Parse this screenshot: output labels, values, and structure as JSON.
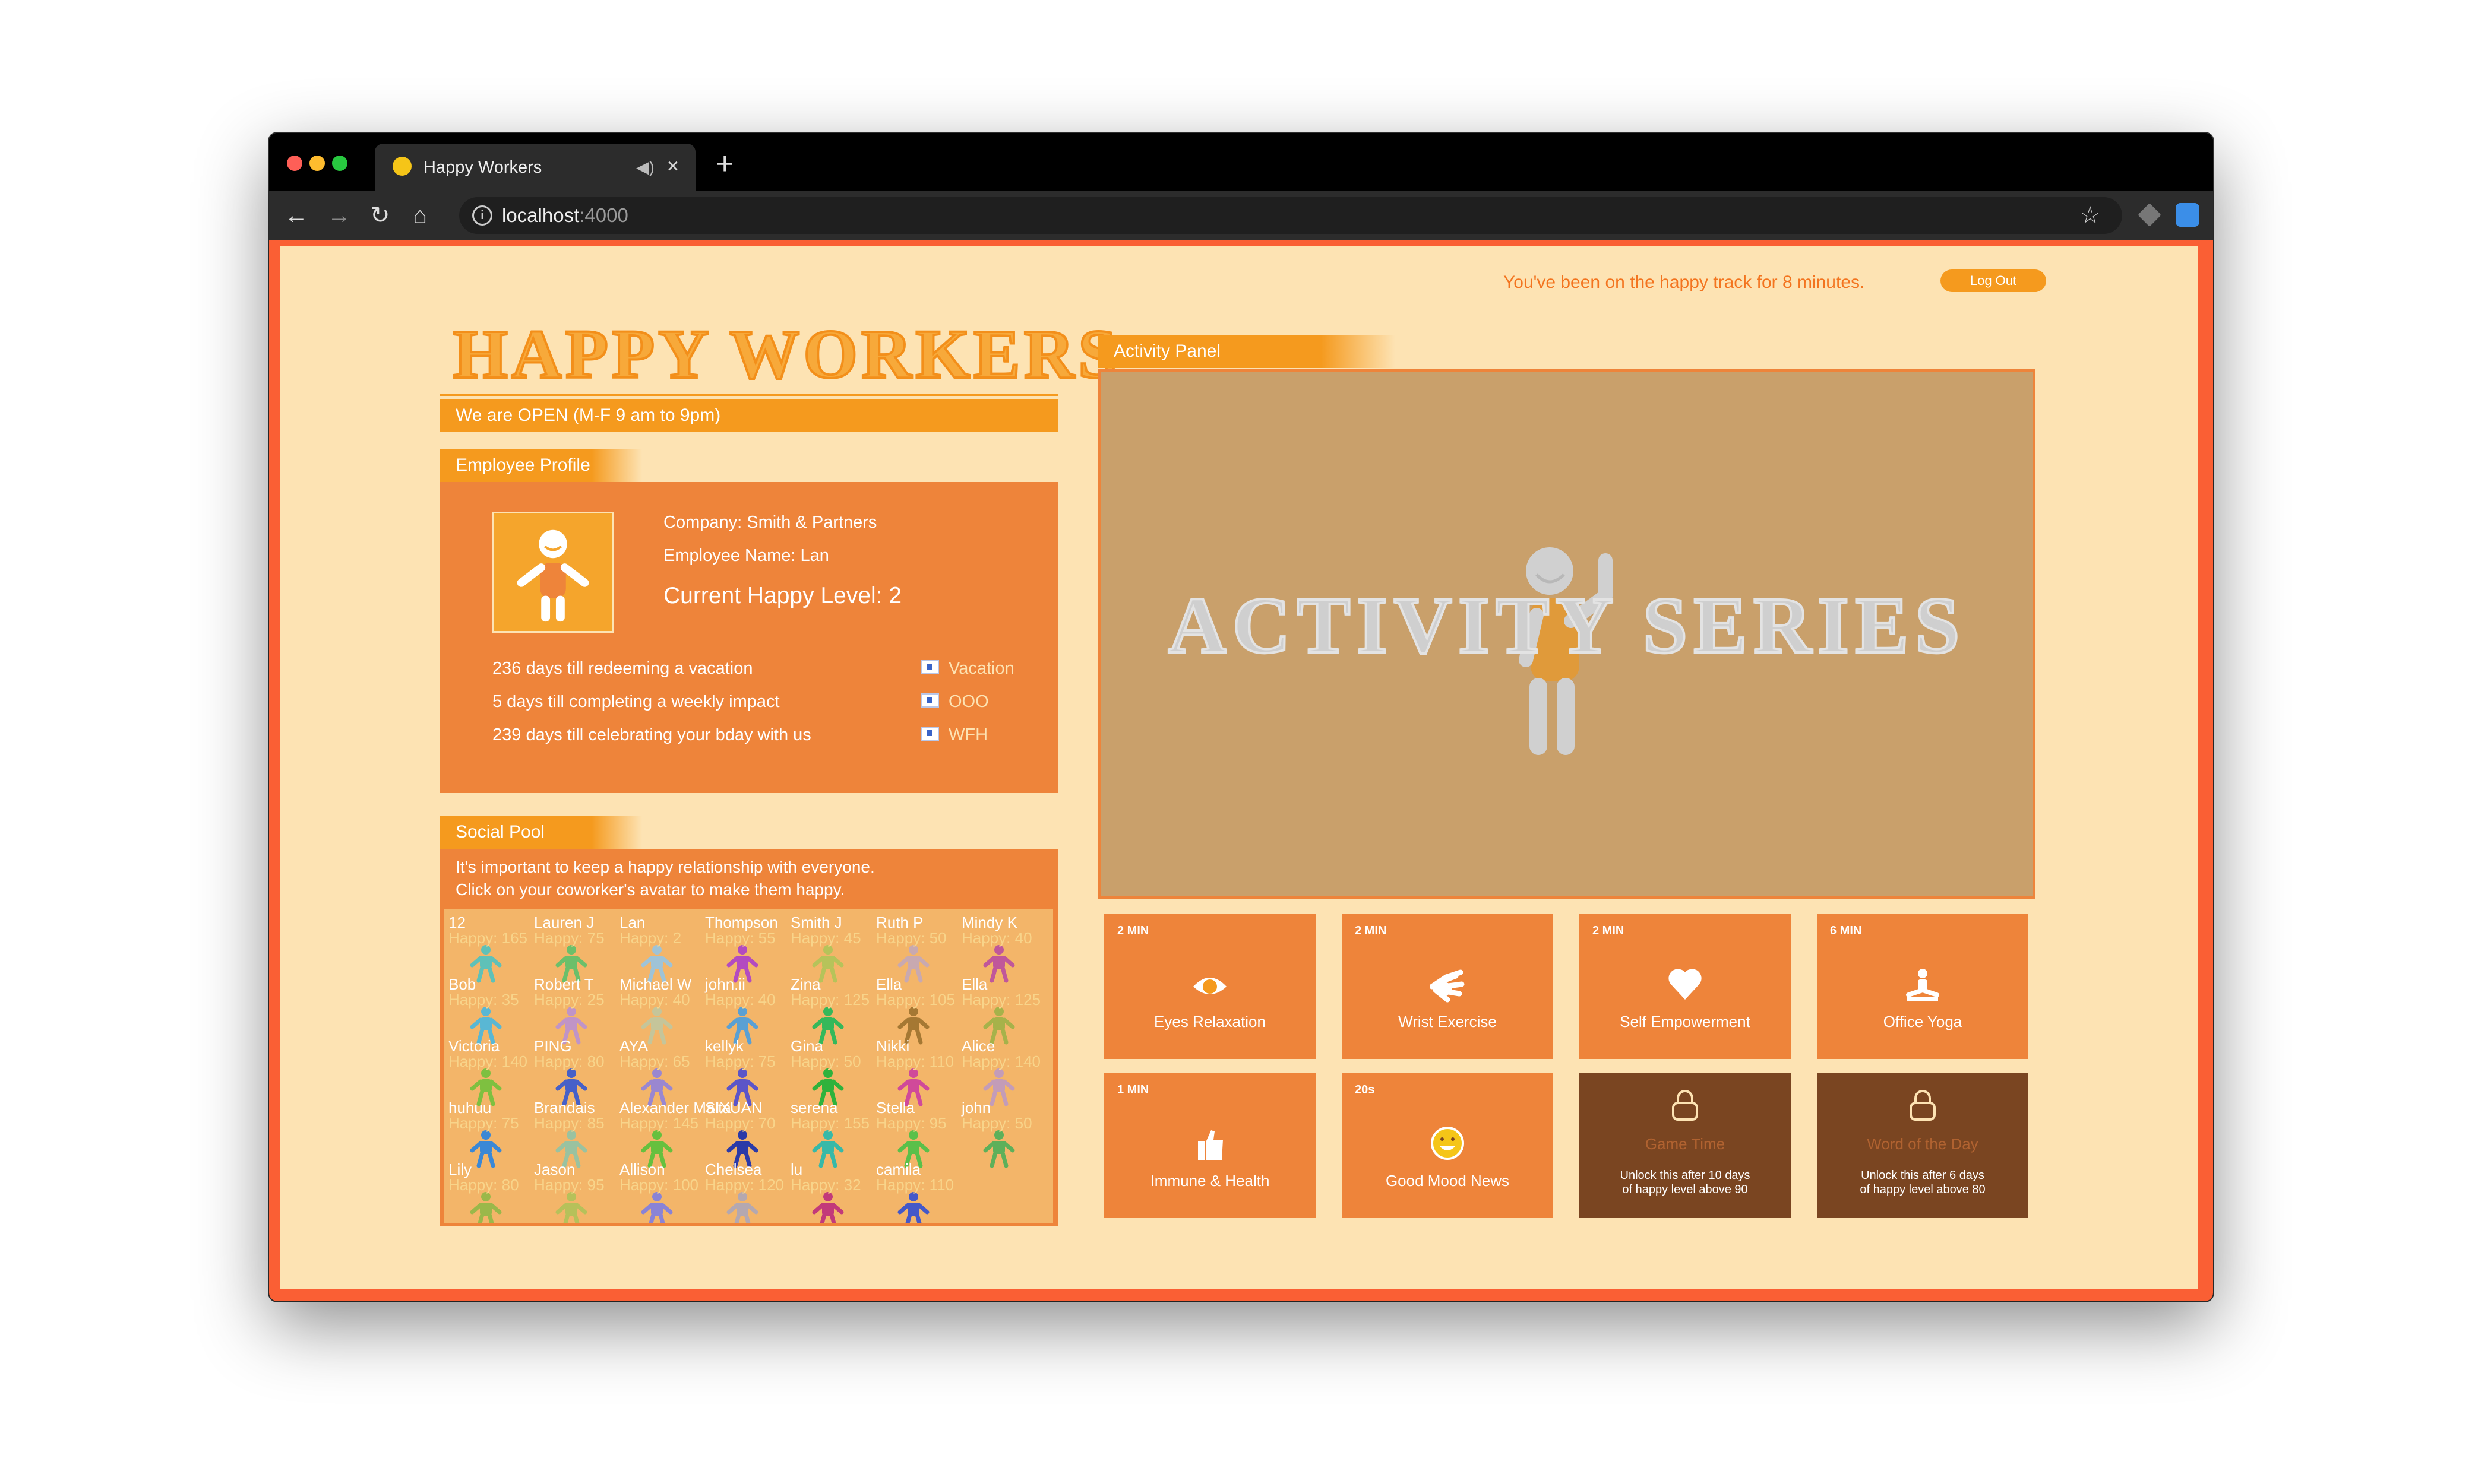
{
  "browser": {
    "tab_title": "Happy Workers",
    "tab_audio": "◀)",
    "tab_close": "×",
    "new_tab": "+",
    "back": "←",
    "forward": "→",
    "reload": "↻",
    "home": "⌂",
    "info": "i",
    "url_host": "localhost",
    "url_port": ":4000",
    "bookmark": "☆",
    "traffic_lights": [
      "#fe5f57",
      "#febc2e",
      "#28c840"
    ]
  },
  "header": {
    "track_message": "You've been on the happy track for 8 minutes.",
    "logout_label": "Log Out"
  },
  "logo": {
    "title": "HAPPY WORKERS"
  },
  "hours": {
    "text": "We are OPEN (M-F 9 am to 9pm)"
  },
  "profile": {
    "section_title": "Employee Profile",
    "company": "Company: Smith & Partners",
    "employee_name": "Employee Name: Lan",
    "happy_level": "Current Happy Level: 2",
    "countdowns": [
      {
        "text": "236 days till redeeming a vacation",
        "link": "Vacation"
      },
      {
        "text": "5 days till completing a weekly impact",
        "link": "OOO"
      },
      {
        "text": "239 days till celebrating your bday with us",
        "link": "WFH"
      }
    ]
  },
  "social": {
    "section_title": "Social Pool",
    "intro_1": "It's important to keep a happy relationship with everyone.",
    "intro_2": "Click on your coworker's avatar to make them happy.",
    "workers": [
      {
        "name": "12",
        "happy": "Happy: 165",
        "color": "#5fc1b8"
      },
      {
        "name": "Lauren J",
        "happy": "Happy: 75",
        "color": "#6cbf6a"
      },
      {
        "name": "Lan",
        "happy": "Happy: 2",
        "color": "#9fc3d6"
      },
      {
        "name": "Thompson",
        "happy": "Happy: 55",
        "color": "#b34bc0"
      },
      {
        "name": "Smith J",
        "happy": "Happy: 45",
        "color": "#b6c35a"
      },
      {
        "name": "Ruth P",
        "happy": "Happy: 50",
        "color": "#c8a9b0"
      },
      {
        "name": "Mindy K",
        "happy": "Happy: 40",
        "color": "#c0579a"
      },
      {
        "name": "Bob",
        "happy": "Happy: 35",
        "color": "#59b7d4"
      },
      {
        "name": "Robert T",
        "happy": "Happy: 25",
        "color": "#c094c7"
      },
      {
        "name": "Michael W",
        "happy": "Happy: 40",
        "color": "#c5c59a"
      },
      {
        "name": "john.ii",
        "happy": "Happy: 40",
        "color": "#5aa0d3"
      },
      {
        "name": "Zina",
        "happy": "Happy: 125",
        "color": "#35b85a"
      },
      {
        "name": "Ella",
        "happy": "Happy: 105",
        "color": "#a57833"
      },
      {
        "name": "Ella",
        "happy": "Happy: 125",
        "color": "#a6b24a"
      },
      {
        "name": "Victoria",
        "happy": "Happy: 140",
        "color": "#7ec040"
      },
      {
        "name": "PING",
        "happy": "Happy: 80",
        "color": "#4660c8"
      },
      {
        "name": "AYA",
        "happy": "Happy: 65",
        "color": "#9a87d0"
      },
      {
        "name": "kellyk",
        "happy": "Happy: 75",
        "color": "#5c55c8"
      },
      {
        "name": "Gina",
        "happy": "Happy: 50",
        "color": "#2fb23c"
      },
      {
        "name": "Nikki",
        "happy": "Happy: 110",
        "color": "#d04a9a"
      },
      {
        "name": "Alice",
        "happy": "Happy: 140",
        "color": "#c39cb8"
      },
      {
        "name": "huhuu",
        "happy": "Happy: 75",
        "color": "#3a88d6"
      },
      {
        "name": "Brandais",
        "happy": "Happy: 85",
        "color": "#9ac2a0"
      },
      {
        "name": "Alexander Malta",
        "happy": "Happy: 145",
        "color": "#66c03e"
      },
      {
        "name": "SIXUAN",
        "happy": "Happy: 70",
        "color": "#2b3aa8"
      },
      {
        "name": "serena",
        "happy": "Happy: 155",
        "color": "#37b9a8"
      },
      {
        "name": "Stella",
        "happy": "Happy: 95",
        "color": "#5ac04a"
      },
      {
        "name": "john",
        "happy": "Happy: 50",
        "color": "#5db05a"
      },
      {
        "name": "Lily",
        "happy": "Happy: 80",
        "color": "#9ab84a"
      },
      {
        "name": "Jason",
        "happy": "Happy: 95",
        "color": "#b6c15a"
      },
      {
        "name": "Allison",
        "happy": "Happy: 100",
        "color": "#8a83d6"
      },
      {
        "name": "Chelsea",
        "happy": "Happy: 120",
        "color": "#b4a8b0"
      },
      {
        "name": "lu",
        "happy": "Happy: 32",
        "color": "#c23a7a"
      },
      {
        "name": "camila",
        "happy": "Happy: 110",
        "color": "#4458c8"
      }
    ]
  },
  "activity": {
    "section_title": "Activity Panel",
    "banner": "ACTIVITY SERIES",
    "tiles": [
      {
        "duration": "2 MIN",
        "label": "Eyes Relaxation",
        "icon": "eye-icon"
      },
      {
        "duration": "2 MIN",
        "label": "Wrist Exercise",
        "icon": "hand-icon"
      },
      {
        "duration": "2 MIN",
        "label": "Self Empowerment",
        "icon": "heart-icon"
      },
      {
        "duration": "6 MIN",
        "label": "Office Yoga",
        "icon": "yoga-icon"
      },
      {
        "duration": "1 MIN",
        "label": "Immune & Health",
        "icon": "thumbs-up-icon"
      },
      {
        "duration": "20s",
        "label": "Good Mood News",
        "icon": "smile-icon"
      }
    ],
    "locked_tiles": [
      {
        "label": "Game Time",
        "unlock_1": "Unlock this after 10 days",
        "unlock_2": "of happy level above 90",
        "icon": "lock-icon"
      },
      {
        "label": "Word of the Day",
        "unlock_1": "Unlock this after 6 days",
        "unlock_2": "of happy level above 80",
        "icon": "lock-icon"
      }
    ]
  }
}
